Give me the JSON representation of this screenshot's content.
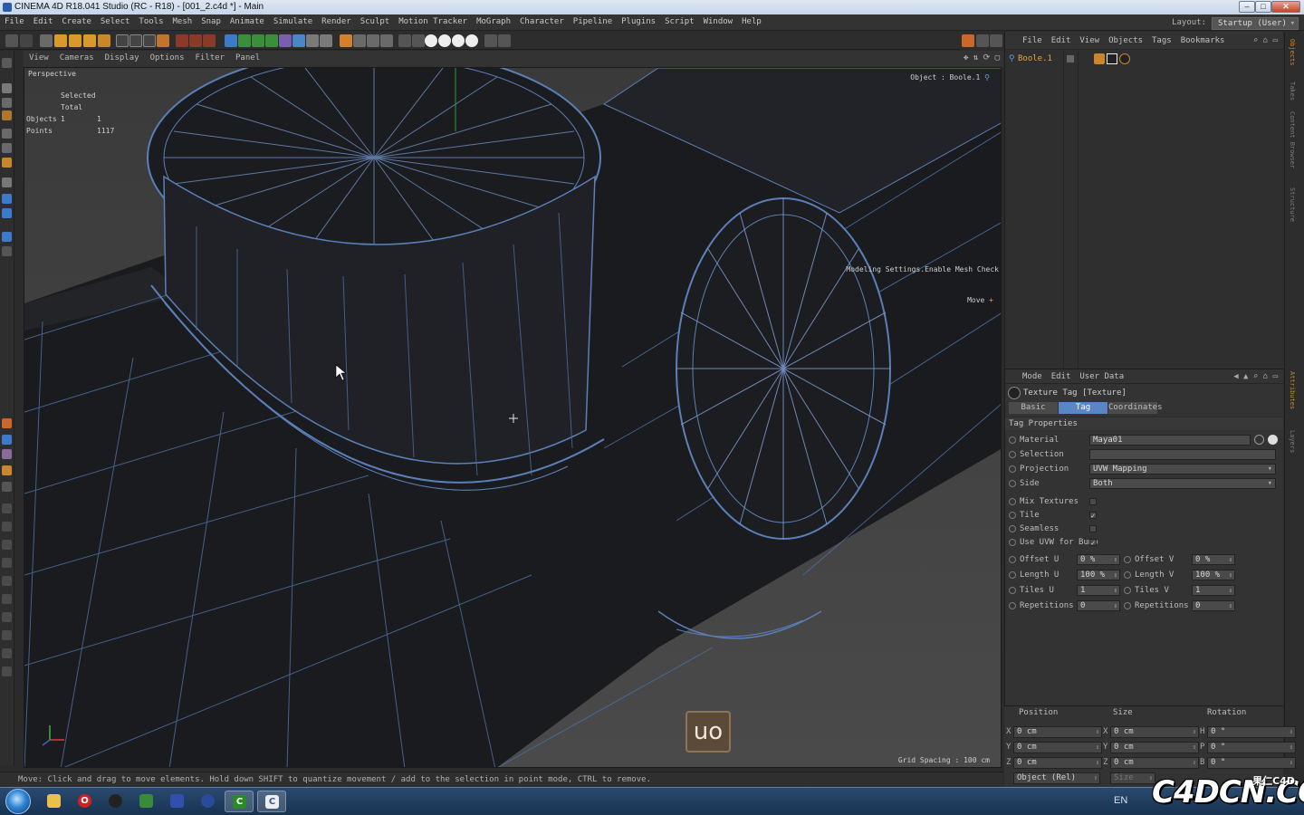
{
  "window": {
    "title": "CINEMA 4D R18.041 Studio (RC - R18) - [001_2.c4d *] - Main"
  },
  "menubar": {
    "items": [
      "File",
      "Edit",
      "Create",
      "Select",
      "Tools",
      "Mesh",
      "Snap",
      "Animate",
      "Simulate",
      "Render",
      "Sculpt",
      "Motion Tracker",
      "MoGraph",
      "Character",
      "Pipeline",
      "Plugins",
      "Script",
      "Window",
      "Help"
    ],
    "layout_label": "Layout:",
    "layout_value": "Startup (User)"
  },
  "viewport": {
    "menu": [
      "View",
      "Cameras",
      "Display",
      "Options",
      "Filter",
      "Panel"
    ],
    "name": "Perspective",
    "stats": {
      "header": "Selected Total",
      "objects_label": "Objects",
      "objects_selected": "1",
      "objects_total": "1",
      "points_label": "Points",
      "points_total": "1117"
    },
    "object_label": "Object : Boole.1",
    "modeling_hint": "Modeling Settings.Enable Mesh Check",
    "move_label": "Move",
    "grid_spacing": "Grid Spacing : 100 cm",
    "key_overlay": "uo"
  },
  "statusbar": {
    "text": "Move: Click and drag to move elements. Hold down SHIFT to quantize movement / add to the selection in point mode, CTRL to remove."
  },
  "object_manager": {
    "menu": [
      "File",
      "Edit",
      "View",
      "Objects",
      "Tags",
      "Bookmarks"
    ],
    "object_name": "Boole.1"
  },
  "side_tabs": [
    "Objects",
    "Takes",
    "Content Browser",
    "Structure",
    "Attributes",
    "Layers"
  ],
  "attributes": {
    "menu": [
      "Mode",
      "Edit",
      "User Data"
    ],
    "title": "Texture Tag [Texture]",
    "tabs": [
      "Basic",
      "Tag",
      "Coordinates"
    ],
    "active_tab": "Tag",
    "section": "Tag Properties",
    "material_label": "Material",
    "material_value": "Maya01",
    "selection_label": "Selection",
    "selection_value": "",
    "projection_label": "Projection",
    "projection_value": "UVW Mapping",
    "side_label": "Side",
    "side_value": "Both",
    "mix_label": "Mix Textures",
    "mix_checked": "",
    "tile_label": "Tile",
    "tile_checked": "✓",
    "seamless_label": "Seamless",
    "seamless_checked": "",
    "useuvw_label": "Use UVW for Bump",
    "useuvw_checked": "✓",
    "offset_u_label": "Offset U",
    "offset_u": "0 %",
    "offset_v_label": "Offset V",
    "offset_v": "0 %",
    "length_u_label": "Length U",
    "length_u": "100 %",
    "length_v_label": "Length V",
    "length_v": "100 %",
    "tiles_u_label": "Tiles U",
    "tiles_u": "1",
    "tiles_v_label": "Tiles V",
    "tiles_v": "1",
    "rep_u_label": "Repetitions U",
    "rep_u": "0",
    "rep_v_label": "Repetitions V",
    "rep_v": "0"
  },
  "coordinates": {
    "headers": [
      "Position",
      "Size",
      "Rotation"
    ],
    "rows": [
      {
        "axis": "X",
        "pos": "0 cm",
        "size_axis": "X",
        "size": "0 cm",
        "rot_axis": "H",
        "rot": "0 °"
      },
      {
        "axis": "Y",
        "pos": "0 cm",
        "size_axis": "Y",
        "size": "0 cm",
        "rot_axis": "P",
        "rot": "0 °"
      },
      {
        "axis": "Z",
        "pos": "0 cm",
        "size_axis": "Z",
        "size": "0 cm",
        "rot_axis": "B",
        "rot": "0 °"
      }
    ],
    "mode": "Object (Rel)",
    "size_mode": "Size"
  },
  "taskbar": {
    "lang": "EN"
  },
  "watermark": {
    "big": "C4DCN.COM",
    "small": "果仁C4D"
  }
}
